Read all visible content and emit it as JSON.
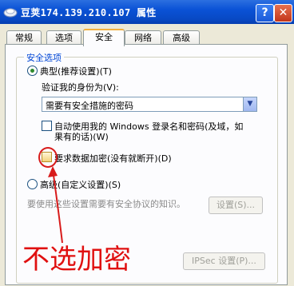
{
  "window": {
    "title": "豆荚174.139.210.107  属性",
    "help_label": "?",
    "close_label": "✕"
  },
  "tabs": [
    {
      "label": "常规"
    },
    {
      "label": "选项"
    },
    {
      "label": "安全",
      "active": true
    },
    {
      "label": "网络"
    },
    {
      "label": "高级"
    }
  ],
  "security": {
    "group_title": "安全选项",
    "typical_label": "典型(推荐设置)(T)",
    "verify_label": "验证我的身份为(V):",
    "verify_value": "需要有安全措施的密码",
    "auto_login_label_line1": "自动使用我的 Windows 登录名和密码(及域，如",
    "auto_login_label_line2": "果有的话)(W)",
    "require_encrypt_label": "要求数据加密(没有就断开)(D)",
    "advanced_label": "高级(自定义设置)(S)",
    "advanced_hint": "要使用这些设置需要有安全协议的知识。",
    "settings_button": "设置(S)...",
    "ipsec_button": "IPSec 设置(P)..."
  },
  "annotation": {
    "text": "不选加密",
    "color": "#e01010"
  }
}
